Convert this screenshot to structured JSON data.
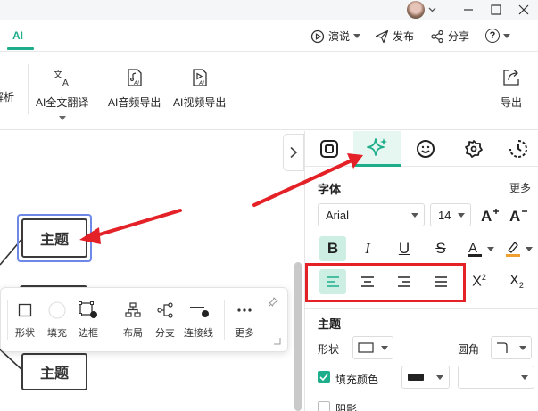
{
  "tabs": {
    "ai": "AI"
  },
  "header_actions": {
    "present": "演说",
    "publish": "发布",
    "share": "分享",
    "help": "?"
  },
  "ribbon": {
    "items": [
      {
        "label": "解析"
      },
      {
        "label": "AI全文翻译"
      },
      {
        "label": "AI音频导出"
      },
      {
        "label": "AI视频导出"
      },
      {
        "label": "导出"
      }
    ]
  },
  "canvas": {
    "topics": [
      {
        "text": "主题"
      },
      {
        "text": "主题"
      }
    ]
  },
  "float_toolbar": {
    "items": [
      {
        "label": "形状"
      },
      {
        "label": "填充"
      },
      {
        "label": "边框"
      },
      {
        "label": "布局"
      },
      {
        "label": "分支"
      },
      {
        "label": "连接线"
      },
      {
        "label": "更多"
      }
    ]
  },
  "panel": {
    "font_section": {
      "title": "字体",
      "more": "更多",
      "family": "Arial",
      "size": "14"
    },
    "topic_section": {
      "title": "主题",
      "shape_label": "形状",
      "corner_label": "圆角",
      "fill_label": "填充颜色",
      "shadow_label": "阴影"
    }
  },
  "colors": {
    "accent": "#1fae8b",
    "highlight": "#e32127",
    "selection": "#6e88e8"
  }
}
